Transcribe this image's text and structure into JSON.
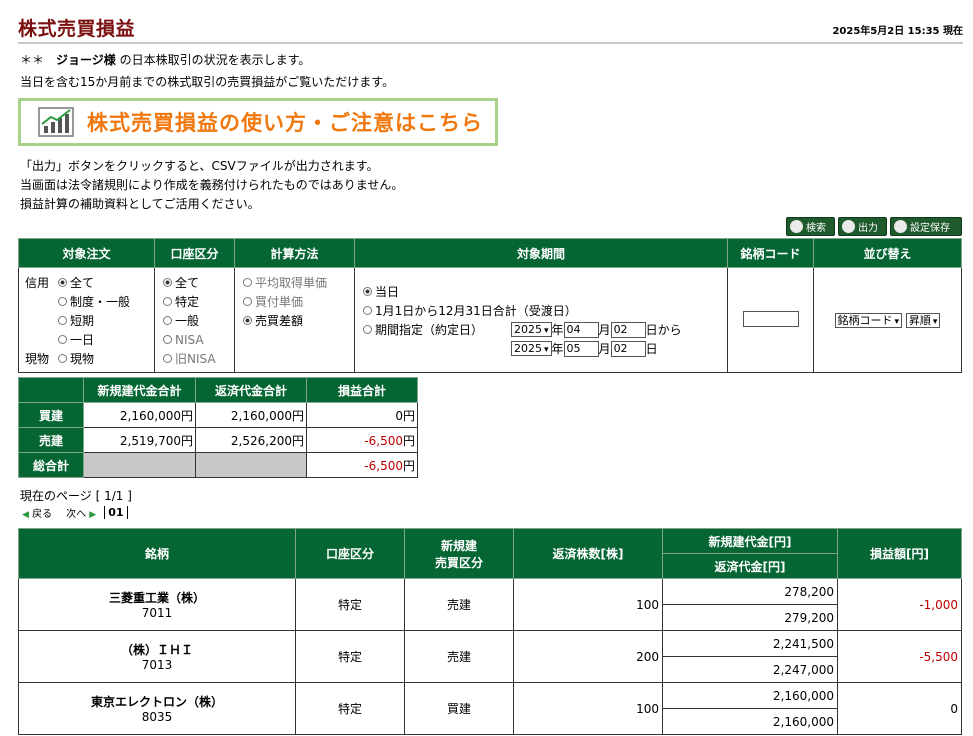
{
  "title": "株式売買損益",
  "timestamp": "2025年5月2日 15:35 現在",
  "intro": {
    "prefix": "＊＊　",
    "user": "ジョージ様",
    "suffix": " の日本株取引の状況を表示します。",
    "line2": "当日を含む15か月前までの株式取引の売買損益がご覧いただけます。"
  },
  "banner": "株式売買損益の使い方・ご注意はこちら",
  "notes": [
    "「出力」ボタンをクリックすると、CSVファイルが出力されます。",
    "当画面は法令諸規則により作成を義務付けられたものではありません。",
    "損益計算の補助資料としてご活用ください。"
  ],
  "toolbar": {
    "search": "検索",
    "output": "出力",
    "save": "設定保存"
  },
  "filters": {
    "headers": [
      "対象注文",
      "口座区分",
      "計算方法",
      "対象期間",
      "銘柄コード",
      "並び替え"
    ],
    "order": {
      "label_credit": "信用",
      "label_cash": "現物",
      "opt_all": "全て",
      "opt_system": "制度・一般",
      "opt_short": "短期",
      "opt_day": "一日",
      "opt_cash": "現物"
    },
    "account": {
      "opts": [
        "全て",
        "特定",
        "一般",
        "NISA",
        "旧NISA"
      ]
    },
    "method": {
      "opts": [
        "平均取得単価",
        "買付単価",
        "売買差額"
      ]
    },
    "period": {
      "opt_today": "当日",
      "opt_year": "1月1日から12月31日合計（受渡日）",
      "opt_range": "期間指定（約定日）",
      "from_year": "2025",
      "from_month": "04",
      "from_day": "02",
      "to_year": "2025",
      "to_month": "05",
      "to_day": "02",
      "suffix_year": "年",
      "suffix_month": "月",
      "suffix_day_from": "日から",
      "suffix_day_to": "日"
    },
    "sort": {
      "key": "銘柄コード",
      "order": "昇順"
    }
  },
  "summary": {
    "headers": [
      "新規建代金合計",
      "返済代金合計",
      "損益合計"
    ],
    "rows": [
      {
        "label": "買建",
        "open": "2,160,000円",
        "close": "2,160,000円",
        "pl_num": "0",
        "pl_unit": "円"
      },
      {
        "label": "売建",
        "open": "2,519,700円",
        "close": "2,526,200円",
        "pl_num": "-6,500",
        "pl_unit": "円"
      },
      {
        "label": "総合計",
        "open": "",
        "close": "",
        "pl_num": "-6,500",
        "pl_unit": "円"
      }
    ]
  },
  "pager": {
    "status": "現在のページ [ 1/1 ]",
    "prev": "戻る",
    "next": "次へ",
    "page": "01"
  },
  "detail": {
    "headers": {
      "name": "銘柄",
      "account": "口座区分",
      "trade_1": "新規建",
      "trade_2": "売買区分",
      "qty": "返済株数[株]",
      "open_amt": "新規建代金[円]",
      "close_amt": "返済代金[円]",
      "pl": "損益額[円]"
    },
    "rows": [
      {
        "name": "三菱重工業（株）",
        "code": "7011",
        "account": "特定",
        "side": "売建",
        "qty": "100",
        "open": "278,200",
        "close": "279,200",
        "pl": "-1,000"
      },
      {
        "name": "（株）ＩＨＩ",
        "code": "7013",
        "account": "特定",
        "side": "売建",
        "qty": "200",
        "open": "2,241,500",
        "close": "2,247,000",
        "pl": "-5,500"
      },
      {
        "name": "東京エレクトロン（株）",
        "code": "8035",
        "account": "特定",
        "side": "買建",
        "qty": "100",
        "open": "2,160,000",
        "close": "2,160,000",
        "pl": "0"
      }
    ]
  },
  "colors": {
    "header_green": "#056533",
    "title_red": "#7a1010",
    "banner_orange": "#f0780f",
    "loss_red": "#c00000"
  }
}
